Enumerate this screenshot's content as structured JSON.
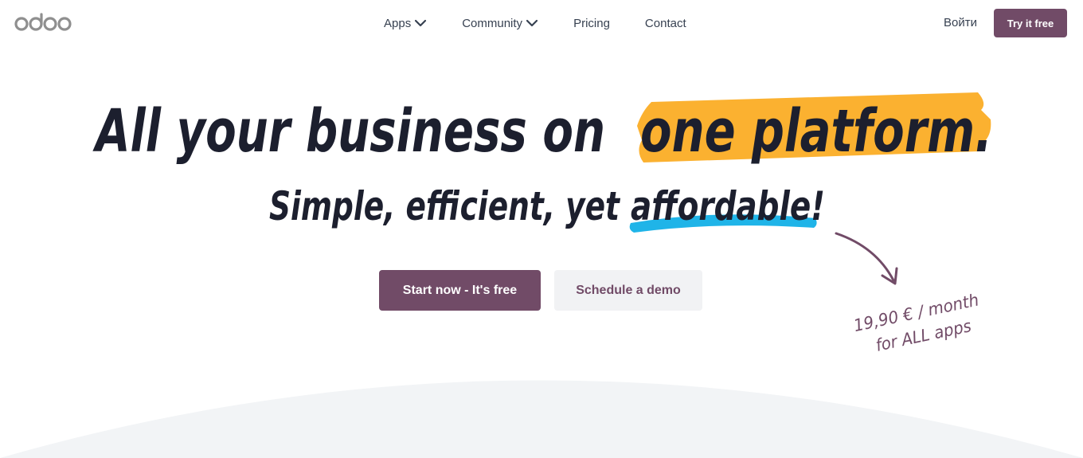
{
  "header": {
    "logo_text": "odoo",
    "nav": [
      {
        "label": "Apps",
        "has_dropdown": true
      },
      {
        "label": "Community",
        "has_dropdown": true
      },
      {
        "label": "Pricing",
        "has_dropdown": false
      },
      {
        "label": "Contact",
        "has_dropdown": false
      }
    ],
    "login_label": "Войти",
    "cta_label": "Try it free"
  },
  "hero": {
    "headline_part1": "All your business on",
    "headline_highlight": "one platform.",
    "subheadline_part1": "Simple, efficient, yet",
    "subheadline_highlight": "affordable!",
    "primary_button": "Start now - It's free",
    "secondary_button": "Schedule a demo",
    "price_line1": "19,90 € / month",
    "price_line2": "for ALL apps"
  },
  "colors": {
    "brand": "#714b67",
    "highlight_yellow": "#fbb130",
    "highlight_blue": "#1fb4e8",
    "curve_bg": "#f2f4f6"
  },
  "icons": {
    "dropdown": "chevron-down-icon",
    "arrow": "curved-arrow-icon"
  }
}
